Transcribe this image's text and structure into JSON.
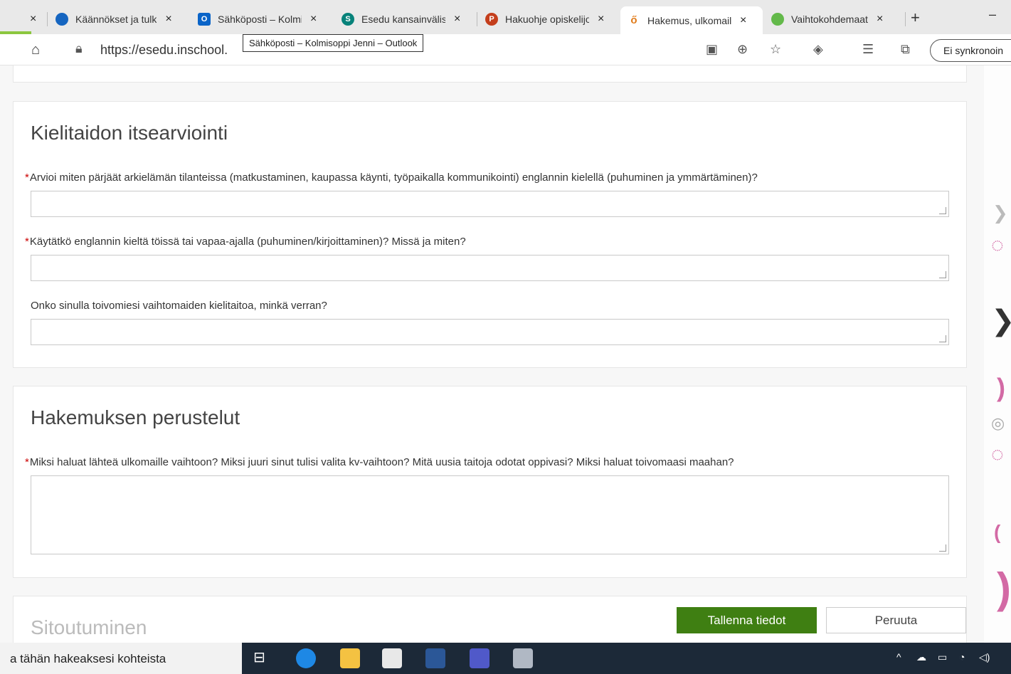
{
  "tabs": [
    {
      "label": "Käännökset ja tulk",
      "icon": "onedrive-icon",
      "color": "#1565c0"
    },
    {
      "label": "Sähköposti – Kolmi",
      "icon": "outlook-icon",
      "color": "#0a64c8"
    },
    {
      "label": "Esedu kansainväliset",
      "icon": "sharepoint-icon",
      "color": "#07827a"
    },
    {
      "label": "Hakuohje opiskelijoille",
      "icon": "powerpoint-icon",
      "color": "#c43e1c"
    },
    {
      "label": "Hakemus, ulkomaille",
      "icon": "app-icon",
      "color": "#e07b1a"
    },
    {
      "label": "Vaihtokohdemaat",
      "icon": "edge-icon",
      "color": "#63b94a"
    }
  ],
  "address": {
    "url": "https://esedu.inschool.",
    "tooltip": "Sähköposti – Kolmisoppi Jenni – Outlook",
    "sync_label": "Ei synkronoin"
  },
  "language_section": {
    "title": "Kielitaidon itsearviointi",
    "questions": [
      {
        "required": true,
        "label": "Arvioi miten pärjäät arkielämän tilanteissa (matkustaminen, kaupassa käynti, työpaikalla kommunikointi) englannin kielellä (puhuminen ja ymmärtäminen)?"
      },
      {
        "required": true,
        "label": "Käytätkö englannin kieltä töissä tai vapaa-ajalla (puhuminen/kirjoittaminen)? Missä ja miten?"
      },
      {
        "required": false,
        "label": "Onko sinulla toivomiesi vaihtomaiden kielitaitoa, minkä verran?"
      }
    ]
  },
  "motivation_section": {
    "title": "Hakemuksen perustelut",
    "question": {
      "required": true,
      "label": "Miksi haluat lähteä ulkomaille vaihtoon? Miksi juuri sinut tulisi valita kv-vaihtoon? Mitä uusia taitoja odotat oppivasi? Miksi haluat toivomaasi maahan?"
    }
  },
  "commitment_section": {
    "title": "Sitoutuminen"
  },
  "actions": {
    "save": "Tallenna tiedot",
    "cancel": "Peruuta"
  },
  "required_marker": "*",
  "taskbar": {
    "search_text": "a tähän hakeaksesi kohteista"
  }
}
